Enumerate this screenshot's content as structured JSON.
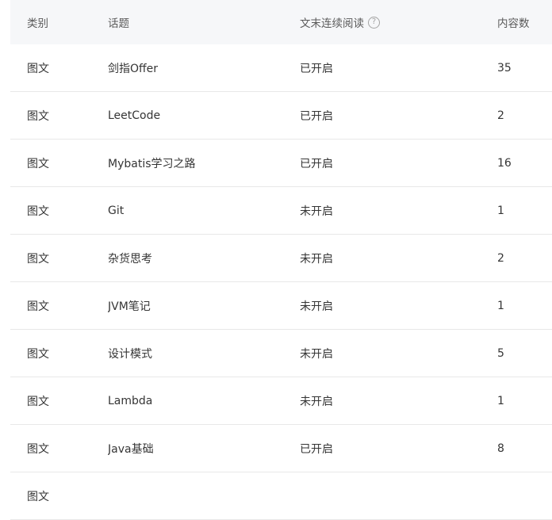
{
  "table": {
    "headers": {
      "type": "类别",
      "topic": "话题",
      "continuous": "文末连续阅读",
      "help_icon": "question-circle-icon",
      "count": "内容数"
    },
    "rows": [
      {
        "type": "图文",
        "topic": "剑指Offer",
        "continuous": "已开启",
        "count": "35"
      },
      {
        "type": "图文",
        "topic": "LeetCode",
        "continuous": "已开启",
        "count": "2"
      },
      {
        "type": "图文",
        "topic": "Mybatis学习之路",
        "continuous": "已开启",
        "count": "16"
      },
      {
        "type": "图文",
        "topic": "Git",
        "continuous": "未开启",
        "count": "1"
      },
      {
        "type": "图文",
        "topic": "杂货思考",
        "continuous": "未开启",
        "count": "2"
      },
      {
        "type": "图文",
        "topic": "JVM笔记",
        "continuous": "未开启",
        "count": "1"
      },
      {
        "type": "图文",
        "topic": "设计模式",
        "continuous": "未开启",
        "count": "5"
      },
      {
        "type": "图文",
        "topic": "Lambda",
        "continuous": "未开启",
        "count": "1"
      },
      {
        "type": "图文",
        "topic": "Java基础",
        "continuous": "已开启",
        "count": "8"
      },
      {
        "type": "图文",
        "topic": "",
        "continuous": "",
        "count": ""
      }
    ]
  }
}
